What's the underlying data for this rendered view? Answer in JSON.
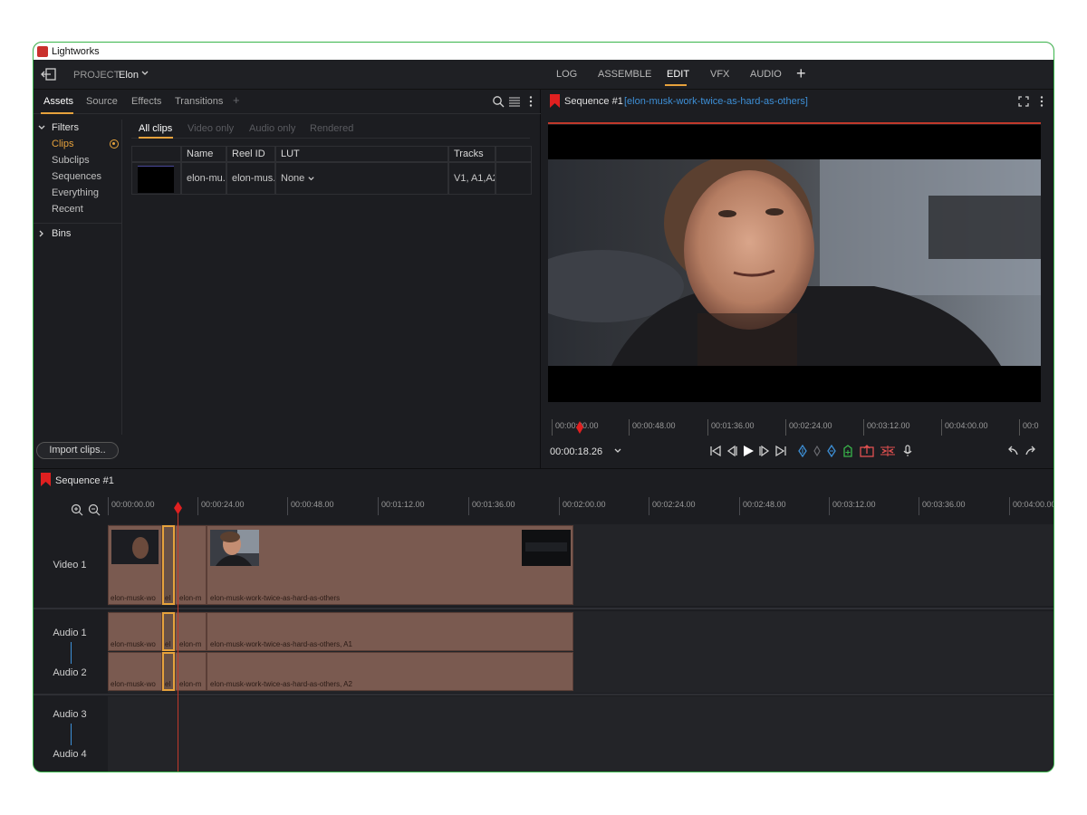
{
  "window": {
    "title": "Lightworks"
  },
  "topbar": {
    "project_label": "PROJECT",
    "project_name": "Elon",
    "tabs": [
      {
        "label": "LOG"
      },
      {
        "label": "ASSEMBLE"
      },
      {
        "label": "EDIT",
        "active": true
      },
      {
        "label": "VFX"
      },
      {
        "label": "AUDIO"
      }
    ],
    "add_label": "+"
  },
  "left_panel": {
    "tabs": [
      {
        "label": "Assets",
        "active": true
      },
      {
        "label": "Source"
      },
      {
        "label": "Effects"
      },
      {
        "label": "Transitions"
      }
    ],
    "add_tab": "+",
    "filters_header": "Filters",
    "filters": [
      "Clips",
      "Subclips",
      "Sequences",
      "Everything",
      "Recent"
    ],
    "active_filter": "Clips",
    "bins_header": "Bins",
    "clip_tabs": [
      "All clips",
      "Video only",
      "Audio only",
      "Rendered"
    ],
    "table": {
      "columns": [
        "Name",
        "Reel ID",
        "LUT",
        "Tracks"
      ],
      "rows": [
        {
          "name": "elon-mu..",
          "reel_id": "elon-mus..",
          "lut": "None",
          "tracks": "V1, A1,A2"
        }
      ]
    },
    "import_button": "Import clips.."
  },
  "viewer": {
    "title": "Sequence #1",
    "subtitle": "[elon-musk-work-twice-as-hard-as-others]",
    "ruler": [
      "00:00:00.00",
      "00:00:48.00",
      "00:01:36.00",
      "00:02:24.00",
      "00:03:12.00",
      "00:04:00.00",
      "00:0"
    ],
    "timecode": "00:00:18.26"
  },
  "sequence": {
    "title": "Sequence #1",
    "ruler": [
      "00:00:00.00",
      "00:00:24.00",
      "00:00:48.00",
      "00:01:12.00",
      "00:01:36.00",
      "00:02:00.00",
      "00:02:24.00",
      "00:02:48.00",
      "00:03:12.00",
      "00:03:36.00",
      "00:04:00.00"
    ],
    "tracks": [
      "Video 1",
      "Audio 1",
      "Audio 2",
      "Audio 3",
      "Audio 4"
    ],
    "clips": {
      "v1_a": "elon-musk-wo",
      "v1_b": "el",
      "v1_c": "elon-m",
      "v1_main": "elon-musk-work-twice-as-hard-as-others",
      "a1_a": "elon-musk-wo",
      "a1_b": "el",
      "a1_c": "elon-m",
      "a1_main": "elon-musk-work-twice-as-hard-as-others, A1",
      "a2_a": "elon-musk-wo",
      "a2_b": "el",
      "a2_c": "elon-m",
      "a2_main": "elon-musk-work-twice-as-hard-as-others, A2"
    }
  },
  "colors": {
    "accent": "#e6a23c",
    "link": "#3d8fd6",
    "playhead": "#c0392b",
    "clip": "#7a5a50"
  }
}
